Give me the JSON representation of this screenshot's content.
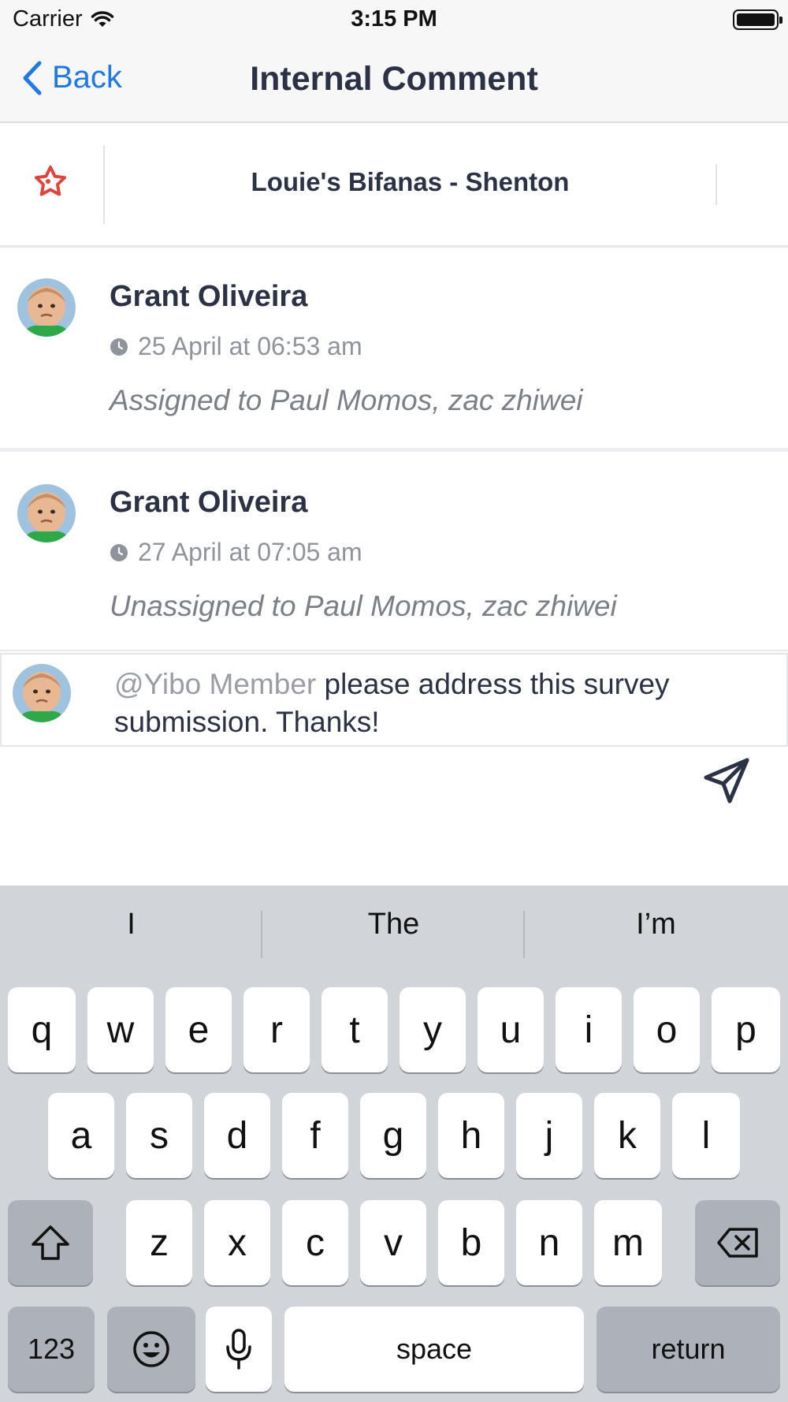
{
  "status_bar": {
    "carrier": "Carrier",
    "time": "3:15 PM"
  },
  "nav": {
    "back_label": "Back",
    "title": "Internal Comment"
  },
  "store": {
    "name": "Louie's Bifanas - Shenton",
    "icon": "store-star-icon",
    "accent_color": "#e0443a"
  },
  "comments": [
    {
      "author": "Grant Oliveira",
      "time": "25 April at 06:53 am",
      "text": "Assigned to Paul Momos, zac zhiwei"
    },
    {
      "author": "Grant Oliveira",
      "time": "27 April at 07:05 am",
      "text": "Unassigned to Paul Momos, zac zhiwei"
    }
  ],
  "composer": {
    "mention": "@Yibo Member",
    "text": " please address this survey submission. Thanks!",
    "send_icon": "send-icon"
  },
  "keyboard": {
    "suggestions": [
      "I",
      "The",
      "I’m"
    ],
    "row1": [
      "q",
      "w",
      "e",
      "r",
      "t",
      "y",
      "u",
      "i",
      "o",
      "p"
    ],
    "row2": [
      "a",
      "s",
      "d",
      "f",
      "g",
      "h",
      "j",
      "k",
      "l"
    ],
    "row3": [
      "z",
      "x",
      "c",
      "v",
      "b",
      "n",
      "m"
    ],
    "numbers_label": "123",
    "space_label": "space",
    "return_label": "return"
  },
  "colors": {
    "link": "#1f7ae8",
    "keyboard_bg": "#d1d4d9"
  }
}
